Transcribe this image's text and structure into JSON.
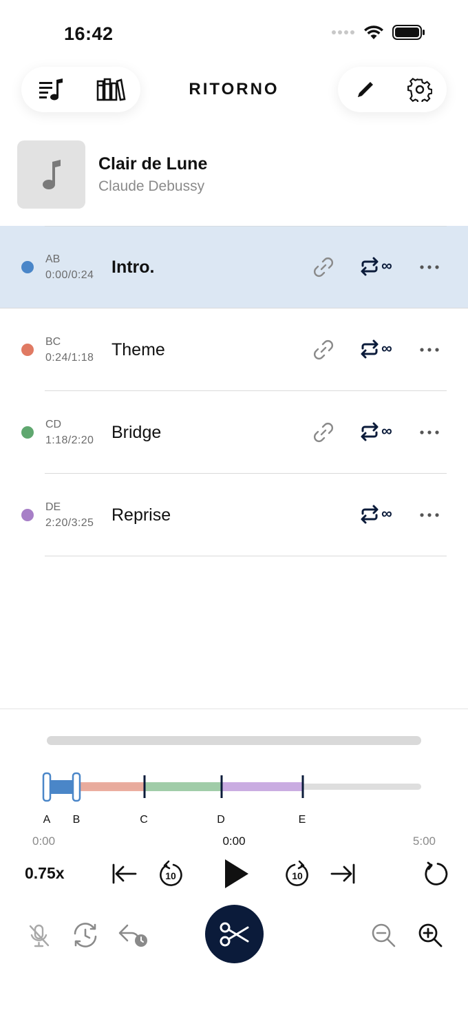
{
  "status_bar": {
    "time": "16:42"
  },
  "header": {
    "brand": "RITORNO"
  },
  "song": {
    "title": "Clair de Lune",
    "artist": "Claude Debussy"
  },
  "segments": [
    {
      "code": "AB",
      "range": "0:00/0:24",
      "name": "Intro.",
      "color": "#4a86c8",
      "active": true,
      "has_link": true
    },
    {
      "code": "BC",
      "range": "0:24/1:18",
      "name": "Theme",
      "color": "#e07a63",
      "active": false,
      "has_link": true
    },
    {
      "code": "CD",
      "range": "1:18/2:20",
      "name": "Bridge",
      "color": "#5fa76f",
      "active": false,
      "has_link": true
    },
    {
      "code": "DE",
      "range": "2:20/3:25",
      "name": "Reprise",
      "color": "#a77fc7",
      "active": false,
      "has_link": false
    }
  ],
  "loop_symbol": "∞",
  "timeline": {
    "markers": [
      "A",
      "B",
      "C",
      "D",
      "E"
    ],
    "start": "0:00",
    "current": "0:00",
    "end": "5:00"
  },
  "transport": {
    "speed": "0.75x",
    "skip_back": "10",
    "skip_forward": "10"
  },
  "colors": {
    "accent_navy": "#0b1b3a",
    "active_row": "#dce7f3"
  }
}
